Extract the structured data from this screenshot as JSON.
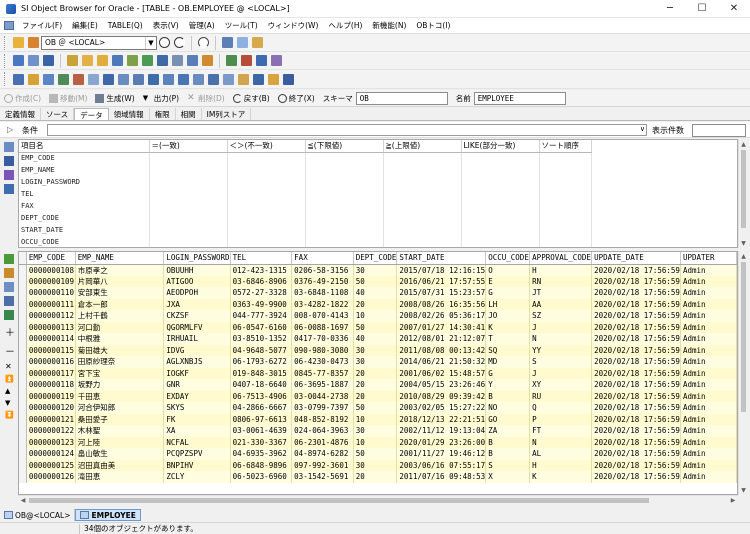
{
  "window": {
    "title": "SI Object Browser for Oracle - [TABLE - OB.EMPLOYEE @ <LOCAL>]",
    "buttons": {
      "minimize": "─",
      "maximize": "☐",
      "close": "✕"
    }
  },
  "menu": [
    "ファイル(F)",
    "編集(E)",
    "TABLE(Q)",
    "表示(V)",
    "管理(A)",
    "ツール(T)",
    "ウィンドウ(W)",
    "ヘルプ(H)",
    "新機能(N)",
    "OBトコ(I)"
  ],
  "toolbar": {
    "connection": "OB ＠ <LOCAL>"
  },
  "actions": {
    "create": "作成(C)",
    "modify": "移動(M)",
    "generate": "生成(W)",
    "output": "出力(P)",
    "delete": "削除(D)",
    "back": "戻す(B)",
    "exit": "終了(X)",
    "schema_label": "スキーマ",
    "schema_value": "OB",
    "name_label": "名前",
    "name_value": "EMPLOYEE"
  },
  "tabs": [
    "定義情報",
    "ソース",
    "データ",
    "領域情報",
    "権限",
    "相関",
    "IM列ストア"
  ],
  "active_tab": 2,
  "conditions": {
    "label": "条件",
    "count_label": "表示件数",
    "headers": [
      "項目名",
      "＝(一致)",
      "＜＞(不一致)",
      "≦(下限値)",
      "≧(上限値)",
      "LIKE(部分一致)",
      "ソート順序"
    ],
    "fields": [
      "EMP_CODE",
      "EMP_NAME",
      "LOGIN_PASSWORD",
      "TEL",
      "FAX",
      "DEPT_CODE",
      "START_DATE",
      "OCCU_CODE"
    ]
  },
  "grid": {
    "headers": [
      "EMP_CODE",
      "EMP_NAME",
      "LOGIN_PASSWORD",
      "TEL",
      "FAX",
      "DEPT_CODE",
      "START_DATE",
      "OCCU_CODE",
      "APPROVAL_CODE",
      "UPDATE_DATE",
      "UPDATER"
    ],
    "rows": [
      [
        "0000000108",
        "市原孝之",
        "OBUUHH",
        "012-423-1315",
        "0206-58-3156",
        "30",
        "2015/07/18 12:16:15",
        "O",
        "H",
        "2020/02/18 17:56:59",
        "Admin"
      ],
      [
        "0000000109",
        "片岡華八",
        "ATIGOO",
        "03-6846-8906",
        "0376-49-2150",
        "50",
        "2016/06/21 17:57:55",
        "E",
        "RN",
        "2020/02/18 17:56:59",
        "Admin"
      ],
      [
        "0000000110",
        "安部東生",
        "AEODPOH",
        "0572-27-3328",
        "03-6848-1108",
        "40",
        "2015/07/31 15:23:57",
        "G",
        "JT",
        "2020/02/18 17:56:59",
        "Admin"
      ],
      [
        "0000000111",
        "倉本一郎",
        "JXA",
        "0363-49-9900",
        "03-4282-1822",
        "20",
        "2008/08/26 16:35:56",
        "LH",
        "AA",
        "2020/02/18 17:56:59",
        "Admin"
      ],
      [
        "0000000112",
        "上村千鶴",
        "CKZSF",
        "044-777-3924",
        "008-070-4143",
        "10",
        "2008/02/26 05:36:17",
        "JO",
        "SZ",
        "2020/02/18 17:56:59",
        "Admin"
      ],
      [
        "0000000113",
        "河口勤",
        "QGORMLFV",
        "06-0547-6160",
        "06-0088-1697",
        "50",
        "2007/01/27 14:30:41",
        "K",
        "J",
        "2020/02/18 17:56:59",
        "Admin"
      ],
      [
        "0000000114",
        "中根雅",
        "IRHUAIL",
        "03-8510-1352",
        "0417-70-0336",
        "40",
        "2012/08/01 21:12:07",
        "T",
        "N",
        "2020/02/18 17:56:59",
        "Admin"
      ],
      [
        "0000000115",
        "菊田雄大",
        "IDVG",
        "04-9648-5077",
        "090-980-3080",
        "30",
        "2011/08/08 00:13:42",
        "SQ",
        "YY",
        "2020/02/18 17:56:59",
        "Admin"
      ],
      [
        "0000000116",
        "田原紗理奈",
        "AGLXNBJS",
        "06-1793-6272",
        "06-4230-0473",
        "30",
        "2014/06/21 21:50:32",
        "MD",
        "S",
        "2020/02/18 17:56:59",
        "Admin"
      ],
      [
        "0000000117",
        "宮下宝",
        "IOGKF",
        "019-848-3015",
        "0845-77-8357",
        "20",
        "2001/06/02 15:48:57",
        "G",
        "J",
        "2020/02/18 17:56:59",
        "Admin"
      ],
      [
        "0000000118",
        "坂野力",
        "GNR",
        "0407-18-6640",
        "06-3695-1887",
        "20",
        "2004/05/15 23:26:46",
        "Y",
        "XY",
        "2020/02/18 17:56:59",
        "Admin"
      ],
      [
        "0000000119",
        "千田恵",
        "EXDAY",
        "06-7513-4906",
        "03-0044-2738",
        "20",
        "2010/08/29 09:39:42",
        "B",
        "RU",
        "2020/02/18 17:56:59",
        "Admin"
      ],
      [
        "0000000120",
        "河合伊知郎",
        "SKYS",
        "04-2866-6667",
        "03-0799-7397",
        "50",
        "2003/02/05 15:27:22",
        "NO",
        "Q",
        "2020/02/18 17:56:59",
        "Admin"
      ],
      [
        "0000000121",
        "桑田愛子",
        "FK",
        "0806-97-6613",
        "048-852-8192",
        "10",
        "2018/12/13 22:21:51",
        "GO",
        "P",
        "2020/02/18 17:56:59",
        "Admin"
      ],
      [
        "0000000122",
        "木林聖",
        "XA",
        "03-0061-4639",
        "024-064-3963",
        "30",
        "2002/11/12 19:13:04",
        "ZA",
        "FT",
        "2020/02/18 17:56:59",
        "Admin"
      ],
      [
        "0000000123",
        "河上陸",
        "NCFAL",
        "021-330-3367",
        "06-2301-4876",
        "10",
        "2020/01/29 23:26:00",
        "B",
        "N",
        "2020/02/18 17:56:59",
        "Admin"
      ],
      [
        "0000000124",
        "畠山敏生",
        "PCQPZSPV",
        "04-6935-3962",
        "04-8974-6282",
        "50",
        "2001/11/27 19:46:12",
        "B",
        "AL",
        "2020/02/18 17:56:59",
        "Admin"
      ],
      [
        "0000000125",
        "沼田真由美",
        "BNPIHV",
        "06-6848-9896",
        "097-992-3601",
        "30",
        "2003/06/16 07:55:17",
        "S",
        "H",
        "2020/02/18 17:56:59",
        "Admin"
      ],
      [
        "0000000126",
        "滝田恵",
        "ZCLY",
        "06-5023-6960",
        "03-1542-5691",
        "20",
        "2011/07/16 09:48:53",
        "X",
        "K",
        "2020/02/18 17:56:59",
        "Admin"
      ]
    ]
  },
  "bottom_tabs": [
    "OB@<LOCAL>",
    "EMPLOYEE"
  ],
  "status": "34個のオブジェクトがあります。",
  "colors": {
    "grid_row": "#fffde0",
    "grid_row_alt": "#fffbcf",
    "active_tab": "#cfe4fb"
  }
}
